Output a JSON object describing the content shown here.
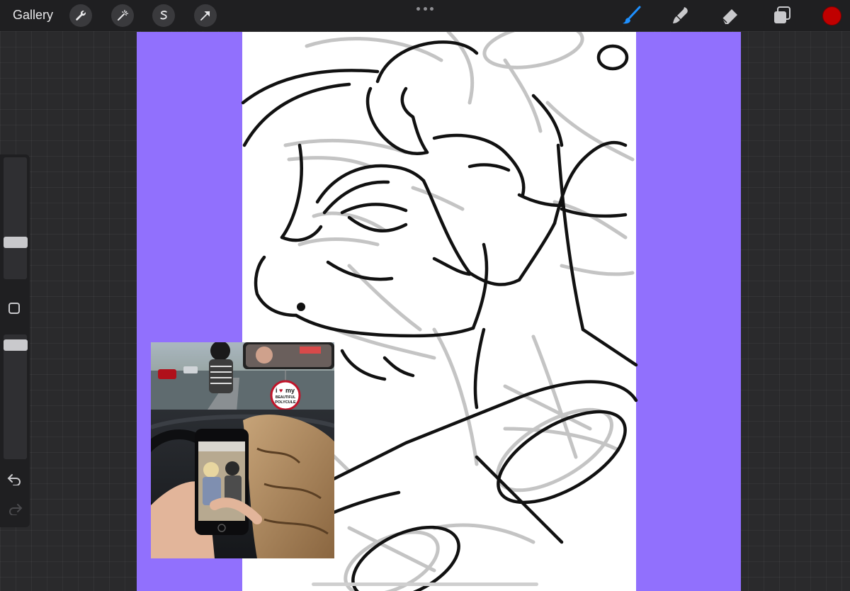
{
  "topbar": {
    "gallery_label": "Gallery",
    "left_tools": [
      "wrench-icon",
      "magic-wand-icon",
      "selection-icon",
      "transform-arrow-icon"
    ],
    "right_tools": [
      "brush-icon",
      "smudge-icon",
      "eraser-icon",
      "layers-icon"
    ],
    "active_tool": "brush-icon",
    "current_color": "#c00000",
    "accent_color": "#1e90ff"
  },
  "sidebar": {
    "brush_size_slider": "brush-size-slider",
    "opacity_slider": "opacity-slider",
    "modifier": "modifier-square-icon",
    "undo": "undo-icon",
    "redo": "redo-icon"
  },
  "canvas": {
    "background_color": "#9170fd",
    "page_color": "#ffffff"
  },
  "reference_image": {
    "sticker_line1": "i",
    "sticker_heart": "♥",
    "sticker_line2": "my",
    "sticker_line3": "BEAUTIFUL",
    "sticker_line4": "POLYCULE"
  }
}
